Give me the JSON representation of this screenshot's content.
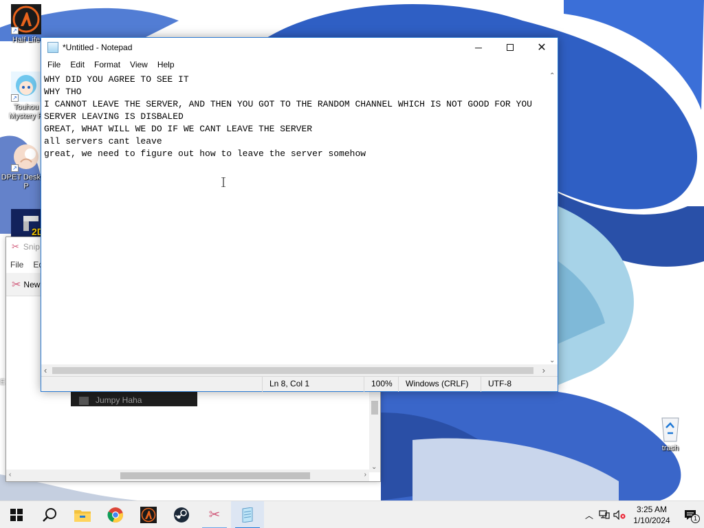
{
  "desktop": {
    "icons": [
      {
        "label": "Half Life",
        "icon": "half-life-icon"
      },
      {
        "label": "Touhou Mystery R",
        "icon": "touhou-icon"
      },
      {
        "label": "DPET Desktop P",
        "icon": "dpet-icon"
      },
      {
        "label": "2D",
        "icon": "2d-game-icon"
      },
      {
        "label": "trash",
        "icon": "recycle-bin-icon"
      }
    ]
  },
  "snipping_tool": {
    "title": "Snip",
    "menu": [
      "File",
      "Ed"
    ],
    "new_label": "New",
    "thumb_text": "Jumpy Haha",
    "side_letter": "E"
  },
  "notepad": {
    "title": "*Untitled - Notepad",
    "menu": [
      "File",
      "Edit",
      "Format",
      "View",
      "Help"
    ],
    "lines": [
      "WHY DID YOU AGREE TO SEE IT",
      "WHY THO",
      "I CANNOT LEAVE THE SERVER, AND THEN YOU GOT TO THE RANDOM CHANNEL WHICH IS NOT GOOD FOR YOU",
      "SERVER LEAVING IS DISBALED",
      "GREAT, WHAT WILL WE DO IF WE CANT LEAVE THE SERVER",
      "all servers cant leave",
      "great, we need to figure out how to leave the server somehow"
    ],
    "status": {
      "position": "Ln 8, Col 1",
      "zoom": "100%",
      "line_ending": "Windows (CRLF)",
      "encoding": "UTF-8"
    }
  },
  "taskbar": {
    "apps": [
      {
        "icon": "windows-start-icon"
      },
      {
        "icon": "search-icon"
      },
      {
        "icon": "file-explorer-icon"
      },
      {
        "icon": "chrome-icon"
      },
      {
        "icon": "half-life-icon"
      },
      {
        "icon": "steam-icon"
      },
      {
        "icon": "snipping-tool-icon"
      },
      {
        "icon": "notepad-icon"
      }
    ],
    "clock": {
      "time": "3:25 AM",
      "date": "1/10/2024"
    },
    "notification_count": "1"
  },
  "colors": {
    "accent": "#1f7ad8",
    "taskbar_bg": "#f0f0f0",
    "wallpaper_blue": "#2f5fc4"
  }
}
